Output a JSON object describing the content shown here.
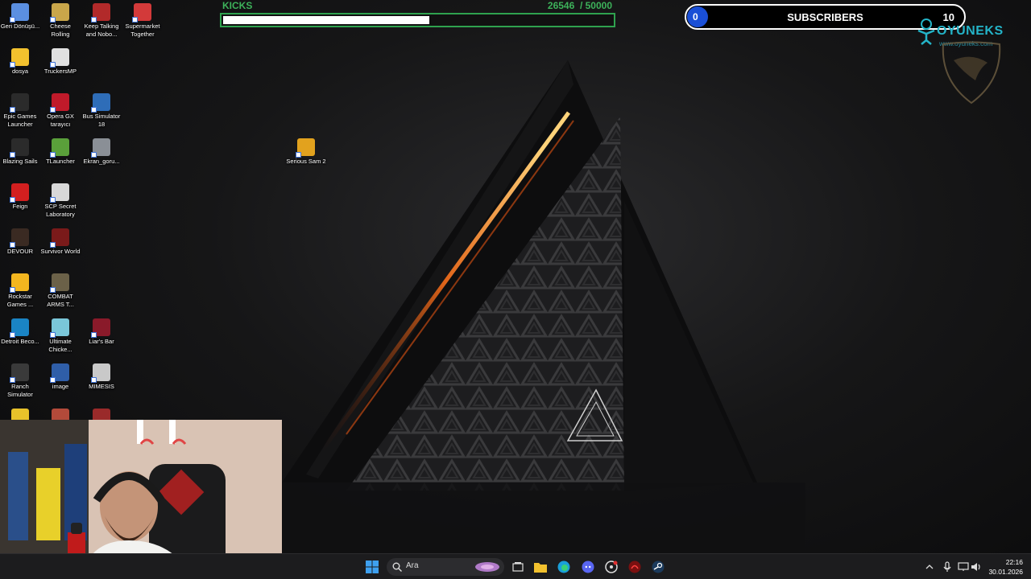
{
  "desktop_icons": [
    {
      "label": "Geri Dönüşü...",
      "icon": "recycle-bin-icon",
      "color": "#5b8fe0"
    },
    {
      "label": "Cheese Rolling",
      "icon": "cheese-rolling-icon",
      "color": "#c9a64a"
    },
    {
      "label": "Keep Talking and Nobo...",
      "icon": "keep-talking-icon",
      "color": "#b22a2a"
    },
    {
      "label": "Supermarket Together",
      "icon": "supermarket-together-icon",
      "color": "#d33a3a"
    },
    {
      "label": "dosya",
      "icon": "folder-icon",
      "color": "#f2c12e"
    },
    {
      "label": "TruckersMP",
      "icon": "truckersmp-icon",
      "color": "#e0e0e0"
    },
    {
      "label": "Epic Games Launcher",
      "icon": "epic-games-icon",
      "color": "#2b2b2b"
    },
    {
      "label": "Opera GX tarayıcı",
      "icon": "opera-gx-icon",
      "color": "#c01a2a"
    },
    {
      "label": "Bus Simulator 18",
      "icon": "bus-simulator-icon",
      "color": "#2e6db8"
    },
    {
      "label": "Blazing Sails",
      "icon": "blazing-sails-icon",
      "color": "#2b2b2b"
    },
    {
      "label": "TLauncher",
      "icon": "tlauncher-icon",
      "color": "#5aa03a"
    },
    {
      "label": "Ekran_goru...",
      "icon": "screenshot-file-icon",
      "color": "#8a8f96"
    },
    {
      "label": "Serious Sam 2",
      "icon": "serious-sam-icon",
      "color": "#e2a21e"
    },
    {
      "label": "Feign",
      "icon": "feign-icon",
      "color": "#d21f1f"
    },
    {
      "label": "SCP Secret Laboratory",
      "icon": "scp-icon",
      "color": "#d8d8d8"
    },
    {
      "label": "DEVOUR",
      "icon": "devour-icon",
      "color": "#3a2a22"
    },
    {
      "label": "Survivor World",
      "icon": "survivor-world-icon",
      "color": "#7a1a1a"
    },
    {
      "label": "Rockstar Games ...",
      "icon": "rockstar-icon",
      "color": "#f3b61f"
    },
    {
      "label": "COMBAT ARMS T...",
      "icon": "combat-arms-icon",
      "color": "#6b6148"
    },
    {
      "label": "Detroit Beco...",
      "icon": "detroit-icon",
      "color": "#1a84c4"
    },
    {
      "label": "Ultimate Chicke...",
      "icon": "ultimate-chicken-icon",
      "color": "#7ac7d9"
    },
    {
      "label": "Liar's Bar",
      "icon": "liars-bar-icon",
      "color": "#8a1a2a"
    },
    {
      "label": "Ranch Simulator",
      "icon": "ranch-simulator-icon",
      "color": "#3a3a3a"
    },
    {
      "label": "image",
      "icon": "image-file-icon",
      "color": "#2f5ea8"
    },
    {
      "label": "MIMESIS",
      "icon": "mimesis-icon",
      "color": "#c9c9c9"
    },
    {
      "label": "",
      "icon": "partial-icon-1",
      "color": "#e8c22a"
    },
    {
      "label": "",
      "icon": "partial-icon-2",
      "color": "#b34a3a"
    },
    {
      "label": "",
      "icon": "partial-icon-3",
      "color": "#9a2a2a"
    }
  ],
  "kicks": {
    "title": "KICKS",
    "count": "26546",
    "goal": "/ 50000",
    "progress": 0.53,
    "accent": "#3db25a"
  },
  "subscribers": {
    "current": "0",
    "label": "SUBSCRIBERS",
    "goal": "10",
    "accent": "#1a4fd6"
  },
  "brand": {
    "name": "OYUNEKS",
    "url": "www.oyuneks.com",
    "color": "#24b4c8"
  },
  "taskbar": {
    "search_placeholder": "Ara",
    "apps": [
      "windows-start-icon",
      "search-icon",
      "task-view-icon",
      "file-explorer-icon",
      "edge-icon",
      "discord-icon",
      "steam-helper-icon",
      "msi-icon",
      "steam-icon"
    ],
    "time": "22:16",
    "date": "30.01.2026"
  }
}
